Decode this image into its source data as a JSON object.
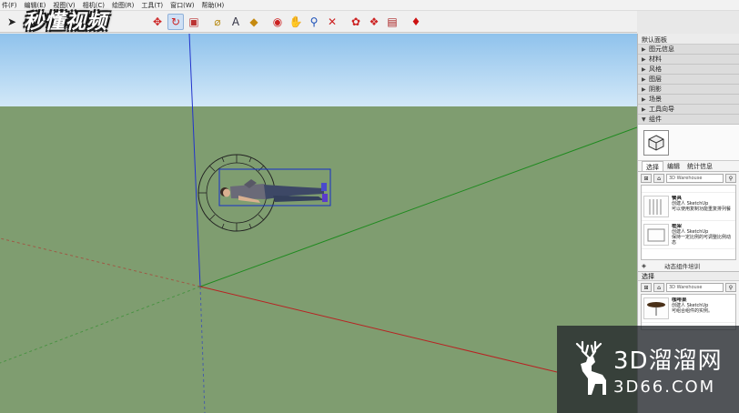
{
  "menubar": {
    "items": [
      "件(F)",
      "编辑(E)",
      "视图(V)",
      "相机(C)",
      "绘图(R)",
      "工具(T)",
      "窗口(W)",
      "帮助(H)"
    ]
  },
  "watermark_top": {
    "text": "秒懂视频"
  },
  "toolbar": {
    "icons": [
      "select-icon",
      "component-icon",
      "paint-icon",
      "eraser-icon",
      "rectangle-icon",
      "line-icon",
      "circle-icon",
      "arc-icon",
      "polygon-icon",
      "freehand-icon",
      "move-icon",
      "push-pull-icon",
      "rotate-icon",
      "follow-me-icon",
      "scale-icon",
      "offset-icon",
      "tape-icon",
      "dimension-icon",
      "protractor-icon",
      "text-icon",
      "axes-icon",
      "3d-text-icon",
      "orbit-icon",
      "pan-icon",
      "zoom-icon",
      "zoom-extents-icon",
      "warehouse-icon",
      "share-model-icon",
      "get-components-icon",
      "ruby-icon"
    ]
  },
  "panel": {
    "title": "默认面板",
    "trays": [
      "图元信息",
      "材料",
      "风格",
      "图层",
      "阴影",
      "场景",
      "工具向导"
    ],
    "components_tray": "组件",
    "tabs": [
      "选择",
      "编辑",
      "统计信息"
    ],
    "search_value": "3D Warehouse",
    "results": [
      {
        "name": "餐具",
        "author": "创建人 SketchUp",
        "desc": "可以使用复制功能重复排列餐"
      },
      {
        "name": "框架",
        "author": "创建人 SketchUp",
        "desc": "保持一定比例的可调整比例动态"
      }
    ],
    "dynamic_label": "动态组件培训",
    "select_label": "选择",
    "search_value_2": "3D Warehouse",
    "results_2": [
      {
        "name": "咖啡桌",
        "author": "创建人 SketchUp",
        "desc": "可组合组件的实例。"
      }
    ]
  },
  "watermark_bottom": {
    "main": "3D溜溜网",
    "sub": "3D66.COM"
  },
  "colors": {
    "sky": "#a9d3f2",
    "ground": "#7f9d70",
    "axis_blue": "#2233cc",
    "axis_green": "#1f8a1f",
    "axis_red": "#b82222"
  }
}
